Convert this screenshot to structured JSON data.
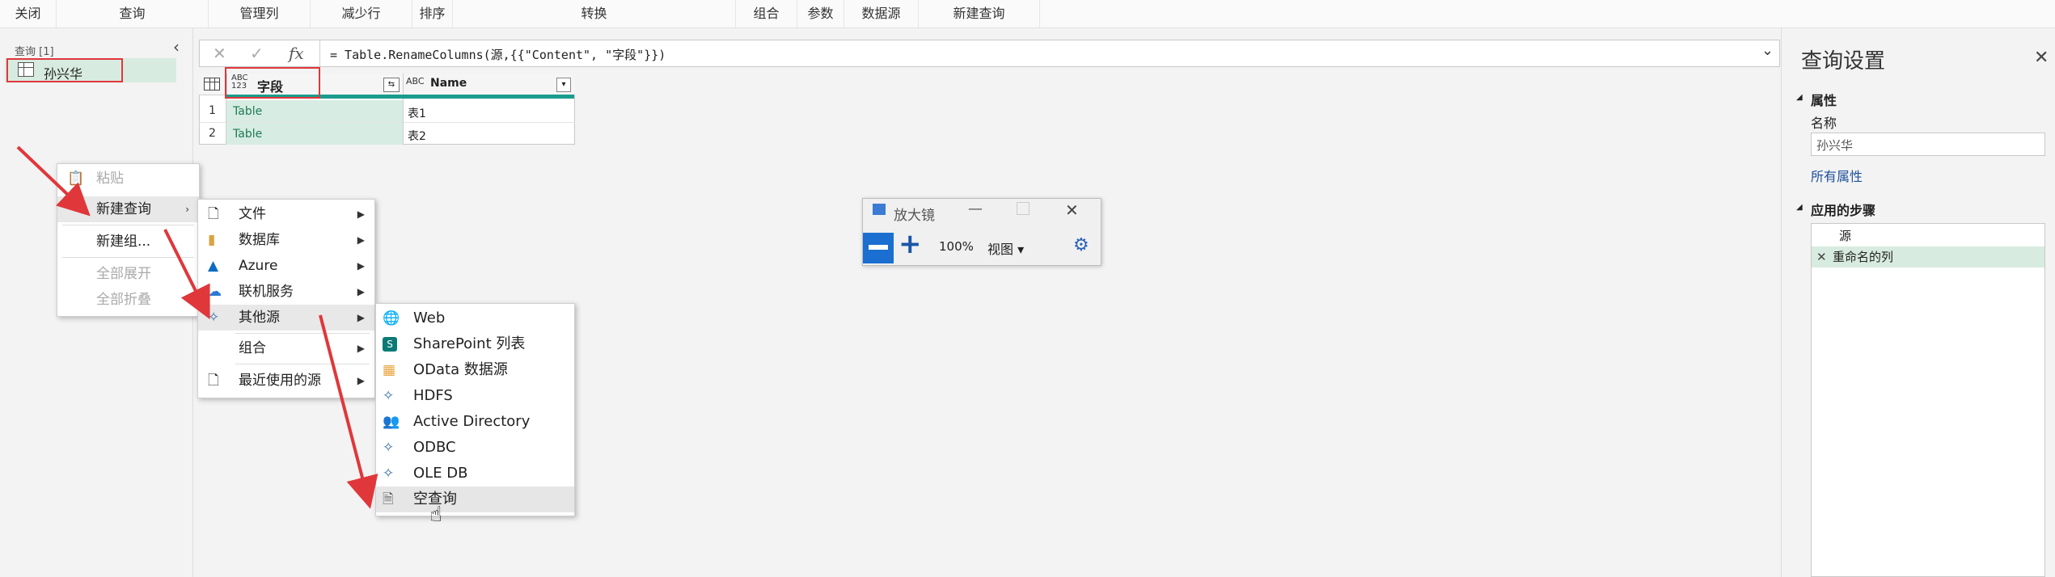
{
  "ribbon": {
    "tabs": [
      "关闭",
      "查询",
      "管理列",
      "减少行",
      "排序",
      "转换",
      "组合",
      "参数",
      "数据源",
      "新建查询"
    ]
  },
  "queries": {
    "header": "查询 [1]",
    "items": [
      {
        "label": "孙兴华"
      }
    ]
  },
  "formula": {
    "text": "= Table.RenameColumns(源,{{\"Content\", \"字段\"}})",
    "fx": "fx"
  },
  "grid": {
    "columns": [
      {
        "type_badge": "ABC\n123",
        "name": "字段"
      },
      {
        "type_badge": "ABC",
        "name": "Name"
      }
    ],
    "rows": [
      {
        "num": "1",
        "c1": "Table",
        "c2": "表1"
      },
      {
        "num": "2",
        "c1": "Table",
        "c2": "表2"
      }
    ]
  },
  "context_menu": {
    "items": [
      {
        "label": "粘贴",
        "disabled": true
      },
      {
        "label": "新建查询",
        "disabled": false,
        "submenu": true
      },
      {
        "label": "新建组...",
        "disabled": false
      },
      {
        "label": "全部展开",
        "disabled": true
      },
      {
        "label": "全部折叠",
        "disabled": true
      }
    ]
  },
  "new_query_menu": {
    "items": [
      {
        "label": "文件",
        "icon": "file-icon"
      },
      {
        "label": "数据库",
        "icon": "database-icon"
      },
      {
        "label": "Azure",
        "icon": "azure-icon"
      },
      {
        "label": "联机服务",
        "icon": "cloud-icon"
      },
      {
        "label": "其他源",
        "icon": "connector-icon"
      },
      {
        "label": "组合",
        "icon": ""
      },
      {
        "label": "最近使用的源",
        "icon": "recent-source-icon"
      }
    ]
  },
  "other_sources_menu": {
    "items": [
      {
        "label": "Web",
        "icon": "globe-icon"
      },
      {
        "label": "SharePoint 列表",
        "icon": "sharepoint-icon"
      },
      {
        "label": "OData 数据源",
        "icon": "odata-icon"
      },
      {
        "label": "HDFS",
        "icon": "connector-icon"
      },
      {
        "label": "Active Directory",
        "icon": "users-icon"
      },
      {
        "label": "ODBC",
        "icon": "connector-icon"
      },
      {
        "label": "OLE DB",
        "icon": "connector-icon"
      },
      {
        "label": "空查询",
        "icon": "blank-query-icon"
      }
    ]
  },
  "magnifier": {
    "title": "放大镜",
    "zoom": "100%",
    "view": "视图"
  },
  "settings": {
    "title": "查询设置",
    "properties_header": "属性",
    "name_label": "名称",
    "name_value": "孙兴华",
    "all_properties": "所有属性",
    "steps_header": "应用的步骤",
    "steps": [
      "源",
      "重命名的列"
    ]
  },
  "colors": {
    "highlight_red": "#e0373b",
    "table_green": "#1a9c8e",
    "selected_bg": "#d8ebe0"
  }
}
